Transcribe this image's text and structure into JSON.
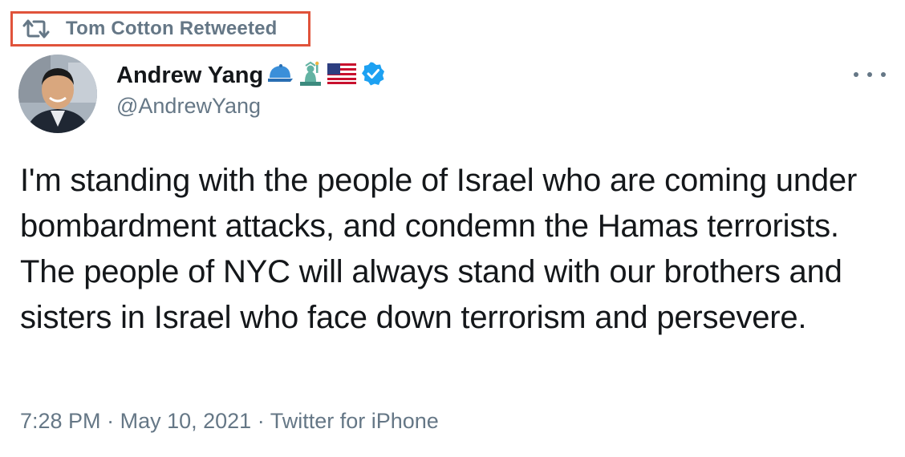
{
  "retweet": {
    "label": "Tom Cotton Retweeted",
    "icon": "retweet-icon"
  },
  "author": {
    "display_name": "Andrew Yang",
    "handle": "@AndrewYang",
    "badges": [
      "cap-emoji",
      "statue-of-liberty-emoji",
      "us-flag-emoji",
      "verified-icon"
    ],
    "verified_color": "#1da1f2"
  },
  "tweet": {
    "text": "I'm standing with the people of Israel who are coming under bombardment attacks, and condemn the Hamas terrorists. The people of NYC will always stand with our brothers and sisters in Israel who face down terrorism and persevere.",
    "time": "7:28 PM",
    "date": "May 10, 2021",
    "source": "Twitter for iPhone"
  },
  "colors": {
    "highlight_border": "#e0533b",
    "secondary_text": "#657786",
    "primary_text": "#14171a"
  }
}
